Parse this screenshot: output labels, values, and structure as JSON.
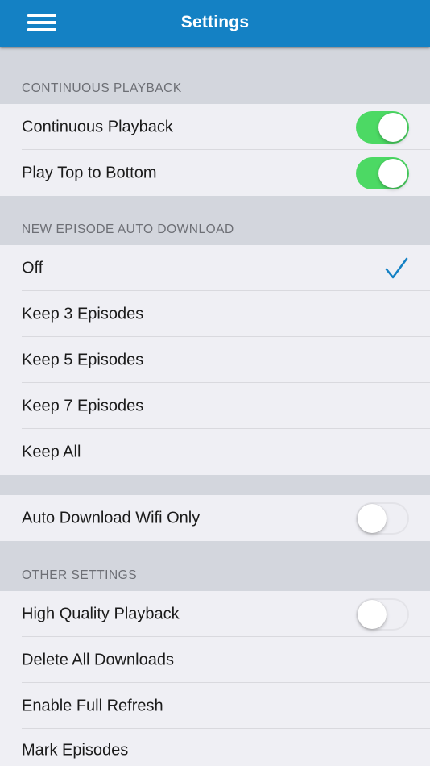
{
  "navbar": {
    "title": "Settings",
    "menu_icon": "hamburger-menu-icon"
  },
  "sections": {
    "continuous_playback": {
      "header": "CONTINUOUS PLAYBACK",
      "rows": [
        {
          "label": "Continuous Playback",
          "toggle": true
        },
        {
          "label": "Play Top to Bottom",
          "toggle": true
        }
      ]
    },
    "auto_download": {
      "header": "NEW EPISODE AUTO DOWNLOAD",
      "selected": "Off",
      "options": [
        "Off",
        "Keep 3 Episodes",
        "Keep 5 Episodes",
        "Keep 7 Episodes",
        "Keep All"
      ]
    },
    "wifi": {
      "rows": [
        {
          "label": "Auto Download Wifi Only",
          "toggle": false
        }
      ]
    },
    "other_settings": {
      "header": "OTHER SETTINGS",
      "rows": [
        {
          "label": "High Quality Playback",
          "toggle": false
        },
        {
          "label": "Delete All Downloads"
        },
        {
          "label": "Enable Full Refresh"
        },
        {
          "label": "Mark Episodes"
        }
      ]
    }
  },
  "colors": {
    "navbar": "#1481c4",
    "toggle_on": "#4cd964",
    "checkmark": "#1481c4",
    "background": "#d3d6dd",
    "row": "#efeff4"
  }
}
